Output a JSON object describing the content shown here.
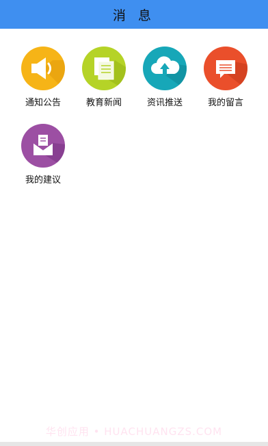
{
  "header": {
    "title": "消 息"
  },
  "tiles": [
    {
      "label": "通知公告",
      "icon": "speaker-icon",
      "color": "#f6b417"
    },
    {
      "label": "教育新闻",
      "icon": "newspaper-icon",
      "color": "#b5d327"
    },
    {
      "label": "资讯推送",
      "icon": "cloud-upload-icon",
      "color": "#17a7b8"
    },
    {
      "label": "我的留言",
      "icon": "message-icon",
      "color": "#ea4f2b"
    },
    {
      "label": "我的建议",
      "icon": "mail-icon",
      "color": "#9c4fa3"
    }
  ],
  "watermark": "华创应用 • HUACHUANGZS.COM"
}
